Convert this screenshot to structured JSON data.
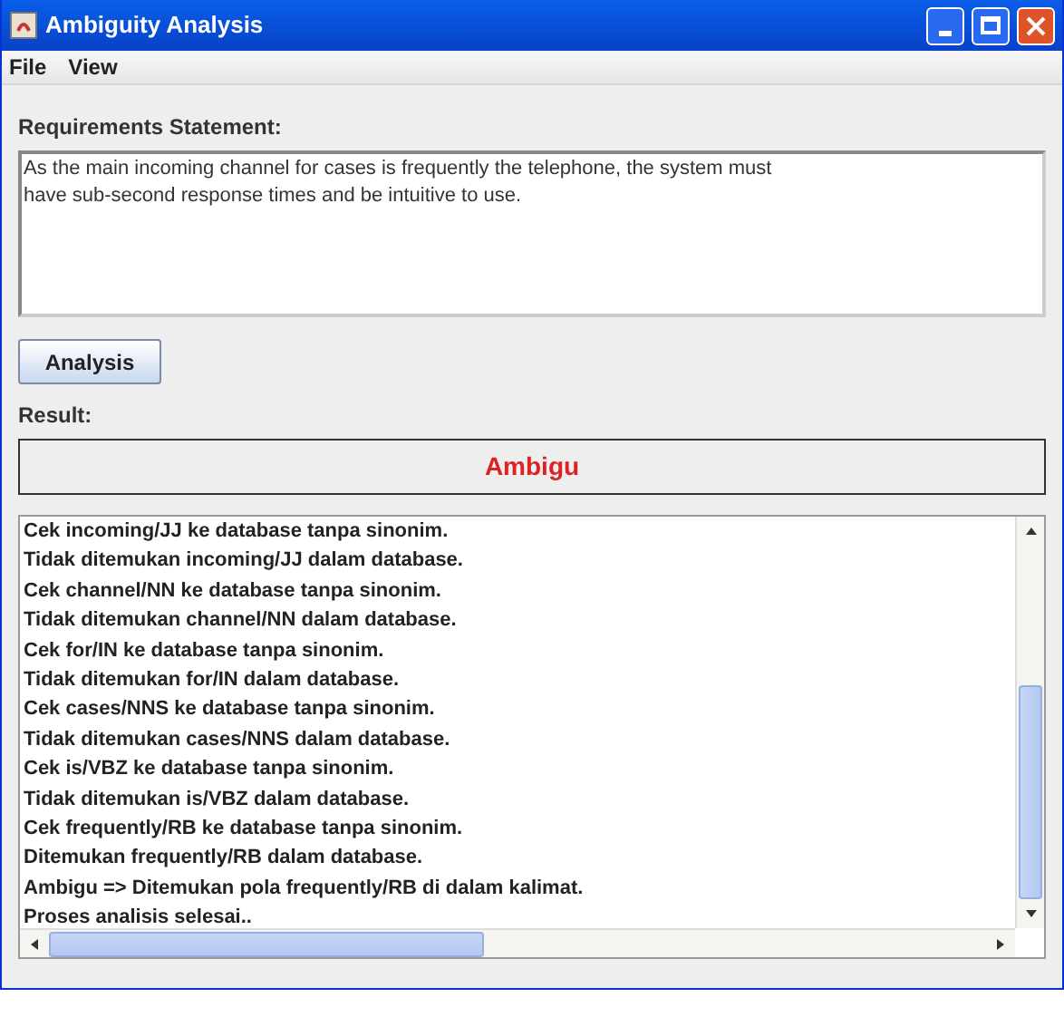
{
  "window": {
    "title": "Ambiguity Analysis"
  },
  "menu": [
    "File",
    "View"
  ],
  "requirements": {
    "label": "Requirements Statement:",
    "value": "As the main incoming channel for cases is frequently the telephone, the system must\nhave sub-second response times and be intuitive to use."
  },
  "analysis_button": "Analysis",
  "result": {
    "label": "Result:",
    "value": "Ambigu"
  },
  "log": [
    "Cek incoming/JJ ke database tanpa sinonim.",
    "Tidak ditemukan incoming/JJ dalam database.",
    "Cek channel/NN ke database tanpa sinonim.",
    "Tidak ditemukan channel/NN dalam database.",
    "Cek for/IN ke database tanpa sinonim.",
    "Tidak ditemukan for/IN dalam database.",
    "Cek cases/NNS ke database tanpa sinonim.",
    "Tidak ditemukan cases/NNS dalam database.",
    "Cek is/VBZ ke database tanpa sinonim.",
    "Tidak ditemukan is/VBZ dalam database.",
    "Cek frequently/RB ke database tanpa sinonim.",
    "Ditemukan frequently/RB dalam database.",
    "Ambigu => Ditemukan pola frequently/RB di dalam kalimat.",
    "Proses analisis selesai.."
  ]
}
